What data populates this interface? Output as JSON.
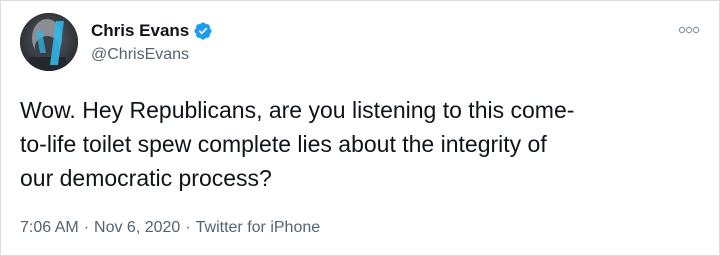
{
  "tweet": {
    "author": {
      "display_name": "Chris Evans",
      "handle": "@ChrisEvans",
      "verified": true,
      "avatar_icon": "profile-photo-icon"
    },
    "more_icon": "ellipsis-icon",
    "text_lines": [
      "Wow. Hey Republicans, are you listening to this come-",
      "to-life toilet spew complete lies about the integrity of",
      "our democratic process?"
    ],
    "meta": {
      "time": "7:06 AM",
      "date": "Nov 6, 2020",
      "source": "Twitter for iPhone",
      "separator": "·"
    }
  },
  "colors": {
    "text": "#0f1419",
    "secondary": "#536471",
    "verified": "#1d9bf0",
    "border": "#d8dde2"
  }
}
